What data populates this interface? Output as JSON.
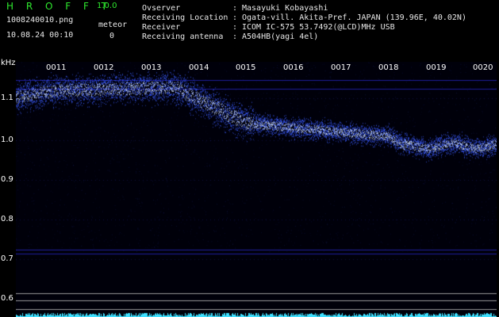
{
  "app": {
    "logo": "H R O F F T",
    "version": "1.0.0",
    "filename": "1008240010.png",
    "datetime": "10.08.24 00:10",
    "meteor_label": "meteor",
    "meteor_count": "0"
  },
  "info": [
    {
      "label": "Ovserver",
      "value": "Masayuki Kobayashi"
    },
    {
      "label": "Receiving Location",
      "value": "Ogata-vill. Akita-Pref. JAPAN (139.96E, 40.02N)"
    },
    {
      "label": "Receiver",
      "value": "ICOM IC-575 53.7492(@LCD)MHz USB"
    },
    {
      "label": "Receiving antenna",
      "value": "A504HB(yagi 4el)"
    }
  ],
  "spectrogram": {
    "y_unit": "kHz",
    "y_ticks": [
      "1.1",
      "1.0",
      "0.9",
      "0.8",
      "0.7",
      "0.6"
    ],
    "x_ticks": [
      "0011",
      "0012",
      "0013",
      "0014",
      "0015",
      "0016",
      "0017",
      "0018",
      "0019",
      "0020"
    ],
    "colors": {
      "signal": "#3a5bff",
      "bright": "#cfe0ff",
      "grid": "#1c1c9a",
      "noise": "#3fe0ff"
    }
  }
}
